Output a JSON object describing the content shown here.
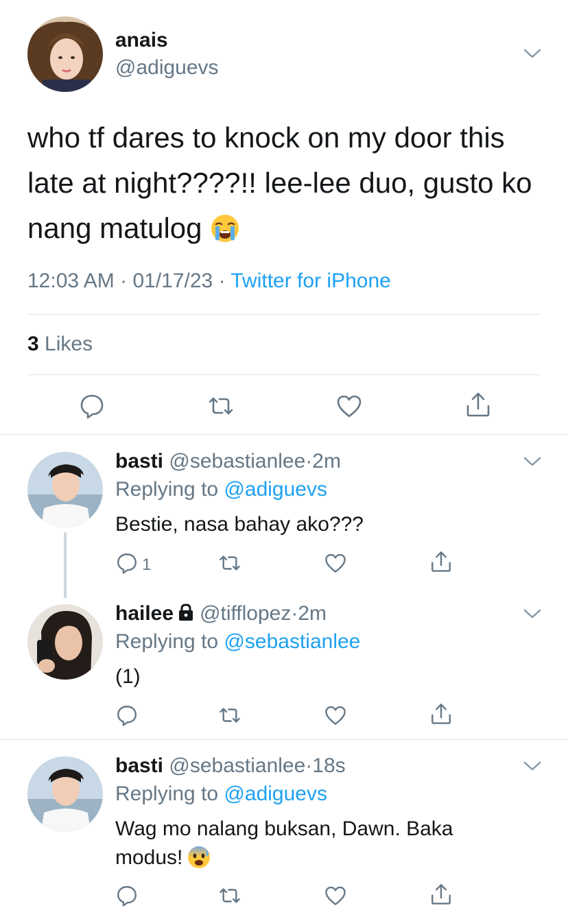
{
  "main_tweet": {
    "name": "anais",
    "handle": "@adiguevs",
    "text": "who tf dares to knock on my door this late at night????!! lee-lee duo, gusto ko nang matulog",
    "emoji": "loudly-crying-face",
    "time": "12:03 AM",
    "date": "01/17/23",
    "source": "Twitter for iPhone",
    "likes_count": "3",
    "likes_label": "Likes"
  },
  "replies": [
    {
      "name": "basti",
      "handle": "@sebastianlee",
      "age": "2m",
      "replying_label": "Replying to",
      "replying_to": "@adiguevs",
      "text": "Bestie, nasa bahay ako???",
      "reply_count": "1"
    },
    {
      "name": "hailee",
      "handle": "@tifflopez",
      "age": "2m",
      "protected_icon": "lock-icon",
      "replying_label": "Replying to",
      "replying_to": "@sebastianlee",
      "text": "(1)"
    },
    {
      "name": "basti",
      "handle": "@sebastianlee",
      "age": "18s",
      "replying_label": "Replying to",
      "replying_to": "@adiguevs",
      "text_line1": "Wag mo nalang buksan, Dawn. Baka",
      "text_line2": "modus!",
      "emoji": "anxious-face-with-sweat"
    }
  ],
  "separator": "·",
  "colors": {
    "primary_text": "#14171a",
    "secondary_text": "#657786",
    "link": "#1da1f2",
    "divider": "#dfe3e8",
    "thread_line": "#ccd6dd"
  }
}
